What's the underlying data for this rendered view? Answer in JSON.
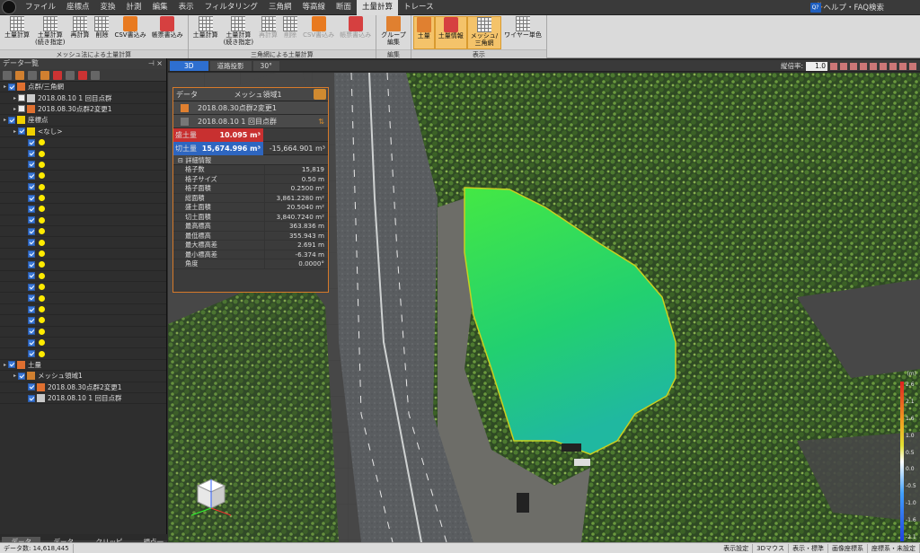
{
  "menubar": {
    "items": [
      "ファイル",
      "座標点",
      "変換",
      "計測",
      "編集",
      "表示",
      "フィルタリング",
      "三角網",
      "等高線",
      "断面",
      "土量計算",
      "トレース"
    ],
    "active": "土量計算",
    "help_label": "ヘルプ・FAQ検索"
  },
  "ribbon": {
    "groups": [
      {
        "label": "メッシュ法による土量計算",
        "buttons": [
          {
            "label": "土量計算",
            "icon": "grid-icon",
            "enabled": true
          },
          {
            "label": "土量計算\n(続き指定)",
            "icon": "grid-icon",
            "enabled": true
          },
          {
            "label": "再計算",
            "icon": "grid-icon",
            "enabled": true
          },
          {
            "label": "削除",
            "icon": "grid-icon",
            "enabled": true
          },
          {
            "label": "CSV書込み",
            "icon": "csv-icon",
            "enabled": true
          },
          {
            "label": "帳票書込み",
            "icon": "report-icon",
            "enabled": true
          }
        ]
      },
      {
        "label": "三角網による土量計算",
        "buttons": [
          {
            "label": "土量計算",
            "icon": "grid-icon",
            "enabled": true
          },
          {
            "label": "土量計算\n(続き指定)",
            "icon": "grid-icon",
            "enabled": true
          },
          {
            "label": "再計算",
            "icon": "grid-icon",
            "enabled": false
          },
          {
            "label": "削除",
            "icon": "grid-icon",
            "enabled": false
          },
          {
            "label": "CSV書込み",
            "icon": "csv-icon",
            "enabled": false
          },
          {
            "label": "帳票書込み",
            "icon": "report-icon",
            "enabled": false
          }
        ]
      },
      {
        "label": "編集",
        "buttons": [
          {
            "label": "グループ\n編集",
            "icon": "group-edit-icon",
            "enabled": true
          }
        ]
      },
      {
        "label": "表示",
        "buttons": [
          {
            "label": "土量",
            "icon": "volume-icon",
            "enabled": true,
            "selected": true
          },
          {
            "label": "土量情報",
            "icon": "volume-info-icon",
            "enabled": true,
            "selected": true
          },
          {
            "label": "メッシュ/\n三角網",
            "icon": "mesh-icon",
            "enabled": true,
            "selected": true
          },
          {
            "label": "ワイヤー単色",
            "icon": "wire-icon",
            "enabled": true
          }
        ]
      }
    ]
  },
  "left_panel": {
    "title": "データ一覧",
    "tree": [
      {
        "level": 0,
        "checked": true,
        "icon": "pointcloud-group-icon",
        "label": "点群/三角網"
      },
      {
        "level": 1,
        "checked": false,
        "icon": "mesh-icon",
        "label": "2018.08.10 1 回目点群"
      },
      {
        "level": 1,
        "checked": false,
        "icon": "pointcloud-icon",
        "label": "2018.08.30点群2変更1"
      },
      {
        "level": 0,
        "checked": true,
        "icon": "coordinate-group-icon",
        "label": "座標点"
      },
      {
        "level": 1,
        "checked": true,
        "icon": "coordinate-icon",
        "label": "<なし>"
      },
      {
        "level": 2,
        "checked": true,
        "icon": "point-icon",
        "label": ""
      },
      {
        "level": 2,
        "checked": true,
        "icon": "point-icon",
        "label": ""
      },
      {
        "level": 2,
        "checked": true,
        "icon": "point-icon",
        "label": ""
      },
      {
        "level": 2,
        "checked": true,
        "icon": "point-icon",
        "label": ""
      },
      {
        "level": 2,
        "checked": true,
        "icon": "point-icon",
        "label": ""
      },
      {
        "level": 2,
        "checked": true,
        "icon": "point-icon",
        "label": ""
      },
      {
        "level": 2,
        "checked": true,
        "icon": "point-icon",
        "label": ""
      },
      {
        "level": 2,
        "checked": true,
        "icon": "point-icon",
        "label": ""
      },
      {
        "level": 2,
        "checked": true,
        "icon": "point-icon",
        "label": ""
      },
      {
        "level": 2,
        "checked": true,
        "icon": "point-icon",
        "label": ""
      },
      {
        "level": 2,
        "checked": true,
        "icon": "point-icon",
        "label": ""
      },
      {
        "level": 2,
        "checked": true,
        "icon": "point-icon",
        "label": ""
      },
      {
        "level": 2,
        "checked": true,
        "icon": "point-icon",
        "label": ""
      },
      {
        "level": 2,
        "checked": true,
        "icon": "point-icon",
        "label": ""
      },
      {
        "level": 2,
        "checked": true,
        "icon": "point-icon",
        "label": ""
      },
      {
        "level": 2,
        "checked": true,
        "icon": "point-icon",
        "label": ""
      },
      {
        "level": 2,
        "checked": true,
        "icon": "point-icon",
        "label": ""
      },
      {
        "level": 2,
        "checked": true,
        "icon": "point-icon",
        "label": ""
      },
      {
        "level": 2,
        "checked": true,
        "icon": "point-icon",
        "label": ""
      },
      {
        "level": 2,
        "checked": true,
        "icon": "point-icon",
        "label": ""
      },
      {
        "level": 0,
        "checked": true,
        "icon": "volume-group-icon",
        "label": "土量"
      },
      {
        "level": 1,
        "checked": true,
        "icon": "mesh-region-icon",
        "label": "メッシュ領域1"
      },
      {
        "level": 2,
        "checked": true,
        "icon": "pointcloud-icon",
        "label": "2018.08.30点群2変更1"
      },
      {
        "level": 2,
        "checked": true,
        "icon": "mesh-icon",
        "label": "2018.08.10 1 回目点群"
      }
    ],
    "tabs": [
      "データ一覧",
      "データ情報",
      "クリッピング",
      "視点一覧"
    ]
  },
  "view": {
    "tabs": [
      "3D",
      "道路投影",
      "30°"
    ],
    "ratio_label": "縦倍率:",
    "ratio_value": "1.0"
  },
  "info_panel": {
    "data_label": "データ",
    "name": "メッシュ領域1",
    "sources": [
      "2018.08.30点群2変更1",
      "2018.08.10 1 回目点群"
    ],
    "fill": {
      "label": "盛土量",
      "value": "10.095 m³",
      "color": "#c83030"
    },
    "cut": {
      "label": "切土量",
      "value": "15,674.996 m³",
      "diff": "-15,664.901 m³",
      "color": "#2e66c0"
    },
    "detail_title": "詳細情報",
    "details": [
      {
        "k": "格子数",
        "v": "15,819"
      },
      {
        "k": "格子サイズ",
        "v": "0.50 m"
      },
      {
        "k": "格子面積",
        "v": "0.2500 m²"
      },
      {
        "k": "総面積",
        "v": "3,861.2280 m²"
      },
      {
        "k": "盛土面積",
        "v": "20.5040 m²"
      },
      {
        "k": "切土面積",
        "v": "3,840.7240 m²"
      },
      {
        "k": "最高標高",
        "v": "363.836 m"
      },
      {
        "k": "最低標高",
        "v": "355.943 m"
      },
      {
        "k": "最大標高差",
        "v": "2.691 m"
      },
      {
        "k": "最小標高差",
        "v": "-6.374 m"
      },
      {
        "k": "角度",
        "v": "0.0000°"
      }
    ]
  },
  "scale": {
    "unit": "(m)",
    "ticks": [
      "2.6",
      "2.1",
      "1.6",
      "1.0",
      "0.5",
      "0.0",
      "-0.5",
      "-1.0",
      "-1.6",
      "-2.1"
    ]
  },
  "statusbar": {
    "items": [
      "データ数: 14,618,445",
      "表示設定",
      "3Dマウス",
      "表示・標準",
      "画像座標系",
      "座標系・未設定"
    ]
  }
}
